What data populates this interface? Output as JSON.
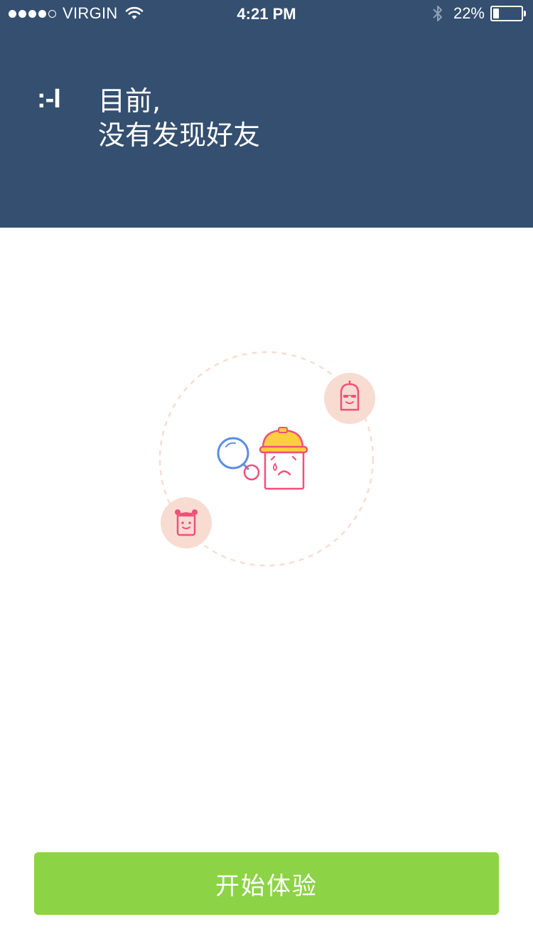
{
  "status_bar": {
    "carrier": "VIRGIN",
    "time": "4:21 PM",
    "battery_percent": "22%",
    "battery_level": 0.22,
    "signal_bars_filled": 4,
    "signal_bars_total": 5
  },
  "header": {
    "emoticon": ":-I",
    "line1": "目前,",
    "line2": "没有发现好友",
    "background": "#344f6f"
  },
  "illustration": {
    "icons": [
      "magnifier-icon",
      "sad-character-helmet-icon",
      "sunglasses-friend-icon",
      "girl-friend-icon"
    ]
  },
  "start_button": {
    "label": "开始体验",
    "color": "#8dd346"
  }
}
